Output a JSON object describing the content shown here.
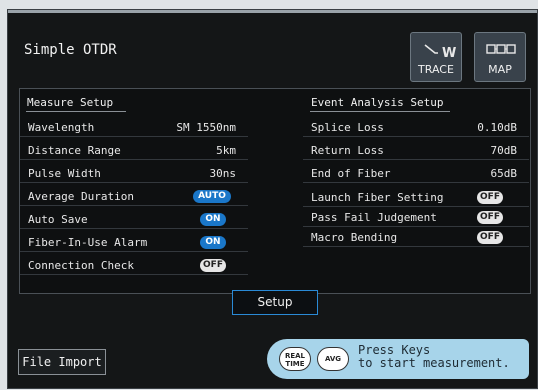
{
  "app": {
    "title": "Simple OTDR"
  },
  "buttons": {
    "trace": "TRACE",
    "map": "MAP"
  },
  "measure_setup": {
    "header": "Measure Setup",
    "rows": [
      {
        "label": "Wavelength",
        "value": "SM 1550nm"
      },
      {
        "label": "Distance Range",
        "value": "5km"
      },
      {
        "label": "Pulse Width",
        "value": "30ns"
      },
      {
        "label": "Average Duration",
        "toggle": "AUTO"
      },
      {
        "label": "Auto Save",
        "toggle": "ON"
      },
      {
        "label": "Fiber-In-Use Alarm",
        "toggle": "ON"
      },
      {
        "label": "Connection Check",
        "toggle": "OFF"
      }
    ]
  },
  "event_setup": {
    "header": "Event Analysis Setup",
    "rows": [
      {
        "label": "Splice Loss",
        "value": "0.10dB"
      },
      {
        "label": "Return Loss",
        "value": "70dB"
      },
      {
        "label": "End of Fiber",
        "value": "65dB"
      },
      {
        "label": "Launch Fiber Setting",
        "toggle": "OFF"
      },
      {
        "label": "Pass Fail Judgement",
        "toggle": "OFF"
      },
      {
        "label": "Macro Bending",
        "toggle": "OFF"
      }
    ]
  },
  "setup_button": "Setup",
  "file_import": "File Import",
  "hint": {
    "realtime_top": "REAL",
    "realtime_bottom": "TIME",
    "avg": "AVG",
    "message": "Press Keys\nto start measurement."
  },
  "colors": {
    "accent": "#1a77c9",
    "bubble": "#a7d4ea",
    "background": "#141617"
  }
}
